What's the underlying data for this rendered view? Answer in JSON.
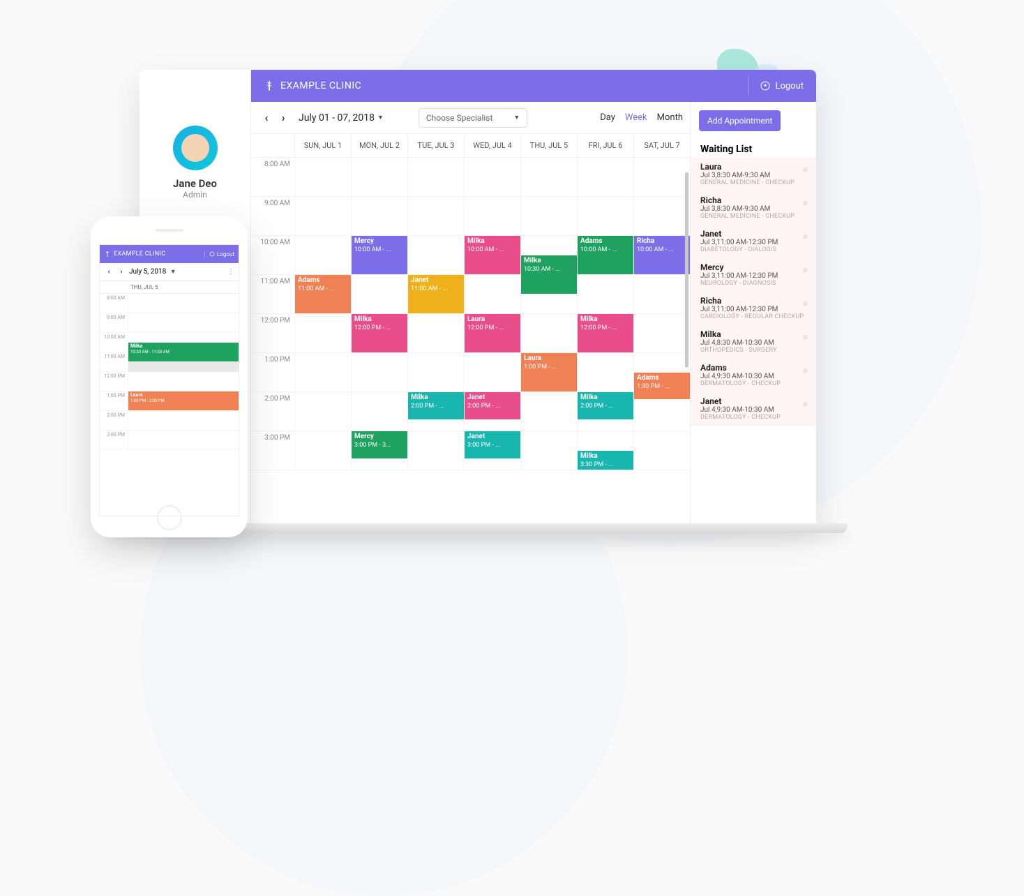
{
  "app_title": "EXAMPLE CLINIC",
  "logout_label": "Logout",
  "user": {
    "name": "Jane Deo",
    "role": "Admin"
  },
  "toolbar": {
    "date_range": "July 01 - 07, 2018",
    "specialist_placeholder": "Choose Specialist",
    "views": {
      "day": "Day",
      "week": "Week",
      "month": "Month"
    },
    "active_view": "week"
  },
  "add_appointment_label": "Add Appointment",
  "waiting_list_title": "Waiting List",
  "day_headers": [
    "SUN, JUL 1",
    "MON, JUL 2",
    "TUE, JUL 3",
    "WED, JUL 4",
    "THU, JUL 5",
    "FRI, JUL 6",
    "SAT, JUL 7"
  ],
  "hours": [
    "8:00 AM",
    "9:00 AM",
    "10:00 AM",
    "11:00 AM",
    "12:00 PM",
    "1:00 PM",
    "2:00 PM",
    "3:00 PM"
  ],
  "events": [
    {
      "day": 1,
      "start": 2,
      "dur": 1,
      "name": "Mercy",
      "time": "10:00 AM - ...",
      "color": "purple"
    },
    {
      "day": 3,
      "start": 2,
      "dur": 1,
      "name": "Milka",
      "time": "10:00 AM - ...",
      "color": "pink"
    },
    {
      "day": 5,
      "start": 2,
      "dur": 1,
      "name": "Adams",
      "time": "10:00 AM - ...",
      "color": "green"
    },
    {
      "day": 6,
      "start": 2,
      "dur": 1,
      "name": "Richa",
      "time": "10:00 AM - ...",
      "color": "purple"
    },
    {
      "day": 4,
      "start": 2.5,
      "dur": 1,
      "name": "Milka",
      "time": "10:30 AM - ...",
      "color": "green"
    },
    {
      "day": 0,
      "start": 3,
      "dur": 1,
      "name": "Adams",
      "time": "11:00 AM - ...",
      "color": "orange"
    },
    {
      "day": 2,
      "start": 3,
      "dur": 1,
      "name": "Janet",
      "time": "11:00 AM - ...",
      "color": "amber"
    },
    {
      "day": 1,
      "start": 4,
      "dur": 1,
      "name": "Milka",
      "time": "12:00 PM - ...",
      "color": "pink"
    },
    {
      "day": 3,
      "start": 4,
      "dur": 1,
      "name": "Laura",
      "time": "12:00 PM - ...",
      "color": "pink"
    },
    {
      "day": 5,
      "start": 4,
      "dur": 1,
      "name": "Milka",
      "time": "12:00 PM - ...",
      "color": "pink"
    },
    {
      "day": 4,
      "start": 5,
      "dur": 1,
      "name": "Laura",
      "time": "1:00 PM - ...",
      "color": "orange"
    },
    {
      "day": 6,
      "start": 5.5,
      "dur": 0.7,
      "name": "Adams",
      "time": "1:30 PM - ...",
      "color": "orange"
    },
    {
      "day": 2,
      "start": 6,
      "dur": 0.7,
      "name": "Milka",
      "time": "2:00 PM - ...",
      "color": "cyan"
    },
    {
      "day": 3,
      "start": 6,
      "dur": 0.7,
      "name": "Janet",
      "time": "2:00 PM - ...",
      "color": "pink"
    },
    {
      "day": 5,
      "start": 6,
      "dur": 0.7,
      "name": "Milka",
      "time": "2:00 PM - ...",
      "color": "cyan"
    },
    {
      "day": 1,
      "start": 7,
      "dur": 0.7,
      "name": "Mercy",
      "time": "3:00 PM - 3...",
      "color": "green"
    },
    {
      "day": 3,
      "start": 7,
      "dur": 0.7,
      "name": "Janet",
      "time": "3:00 PM - ...",
      "color": "cyan"
    },
    {
      "day": 5,
      "start": 7.5,
      "dur": 0.5,
      "name": "Milka",
      "time": "3:30 PM - ...",
      "color": "cyan"
    }
  ],
  "waiting_list": [
    {
      "name": "Laura",
      "time": "Jul 3,8:30 AM-9:30 AM",
      "cat": "GENERAL MEDICINE - CHECKUP"
    },
    {
      "name": "Richa",
      "time": "Jul 3,8:30 AM-9:30 AM",
      "cat": "GENERAL MEDICINE - CHECKUP"
    },
    {
      "name": "Janet",
      "time": "Jul 3,11:00 AM-12:30 PM",
      "cat": "DIABETOLOGY - DIALOGIS"
    },
    {
      "name": "Mercy",
      "time": "Jul 3,11:00 AM-12:30 PM",
      "cat": "NEUROLOGY - DIAGNOSIS"
    },
    {
      "name": "Richa",
      "time": "Jul 3,11:00 AM-12:30 PM",
      "cat": "CARDIOLOGY - REGULAR CHECKUP"
    },
    {
      "name": "Milka",
      "time": "Jul 4,8:30 AM-10:30 AM",
      "cat": "ORTHOPEDICS - SURGERY"
    },
    {
      "name": "Adams",
      "time": "Jul 4,9:30 AM-10:30 AM",
      "cat": "DERMATOLOGY - CHECKUP"
    },
    {
      "name": "Janet",
      "time": "Jul 4,9:30 AM-10:30 AM",
      "cat": "DERMATOLOGY - CHECKUP"
    }
  ],
  "phone": {
    "title": "EXAMPLE CLINIC",
    "logout": "Logout",
    "date": "July 5, 2018",
    "day_header": "THU, JUL 5",
    "hours": [
      "8:00 AM",
      "9:00 AM",
      "10:00 AM",
      "11:00 AM",
      "12:00 PM",
      "1:00 PM",
      "2:00 PM",
      "3:00 PM"
    ],
    "events": [
      {
        "start": 2.5,
        "dur": 1,
        "name": "Milka",
        "time": "10:30 AM - 11:30 AM",
        "color": "green"
      },
      {
        "start": 5,
        "dur": 1,
        "name": "Laura",
        "time": "1:00 PM - 2:00 PM",
        "color": "orange"
      }
    ]
  }
}
